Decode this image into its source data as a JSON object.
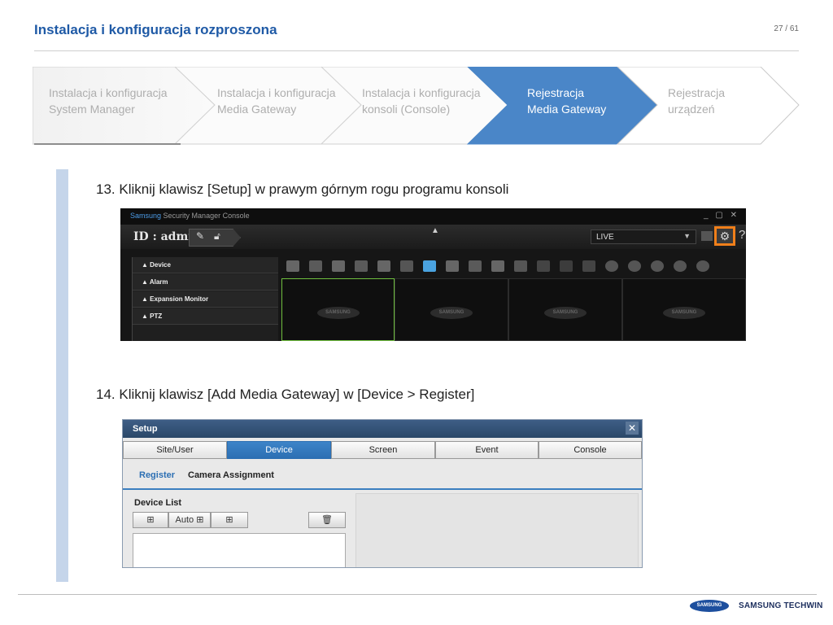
{
  "header": {
    "title": "Instalacja i konfiguracja rozproszona",
    "pager": "27 / 61"
  },
  "steps": [
    {
      "line1": "Instalacja i konfiguracja",
      "line2": "System Manager",
      "active": false
    },
    {
      "line1": "Instalacja i konfiguracja",
      "line2": "Media Gateway",
      "active": false
    },
    {
      "line1": "Instalacja i konfiguracja",
      "line2": "konsoli (Console)",
      "active": false
    },
    {
      "line1": "Rejestracja",
      "line2": "Media Gateway",
      "active": true
    },
    {
      "line1": "Rejestracja",
      "line2": "urządzeń",
      "active": false
    }
  ],
  "step13": {
    "text": "13.  Kliknij klawisz [Setup] w prawym górnym rogu programu konsoli"
  },
  "console": {
    "brand": "Samsung",
    "app_title": "Security Manager Console",
    "window_buttons": "_ ▢ ✕",
    "user_label": "ID : admin",
    "view_mode": "LIVE",
    "help": "?",
    "sidebar_items": [
      "▲  Device",
      "▲  Alarm",
      "▲  Expansion Monitor",
      "▲  PTZ"
    ],
    "cell_logo": "SAMSUNG"
  },
  "step14": {
    "text": "14.  Kliknij klawisz [Add Media Gateway] w [Device > Register]"
  },
  "setup": {
    "title": "Setup",
    "close": "✕",
    "tabs": [
      "Site/User",
      "Device",
      "Screen",
      "Event",
      "Console"
    ],
    "active_tab": "Device",
    "subtabs": {
      "register": "Register",
      "camera": "Camera Assignment"
    },
    "device_list_label": "Device List",
    "auto_label": "Auto"
  },
  "footer": {
    "logo": "SAMSUNG",
    "brand": "SAMSUNG TECHWIN"
  },
  "colors": {
    "title_blue": "#1f5aa6",
    "active_step": "#4a86c8",
    "setup_highlight": "#f07f1a",
    "accent_bar": "#c5d5ea"
  }
}
